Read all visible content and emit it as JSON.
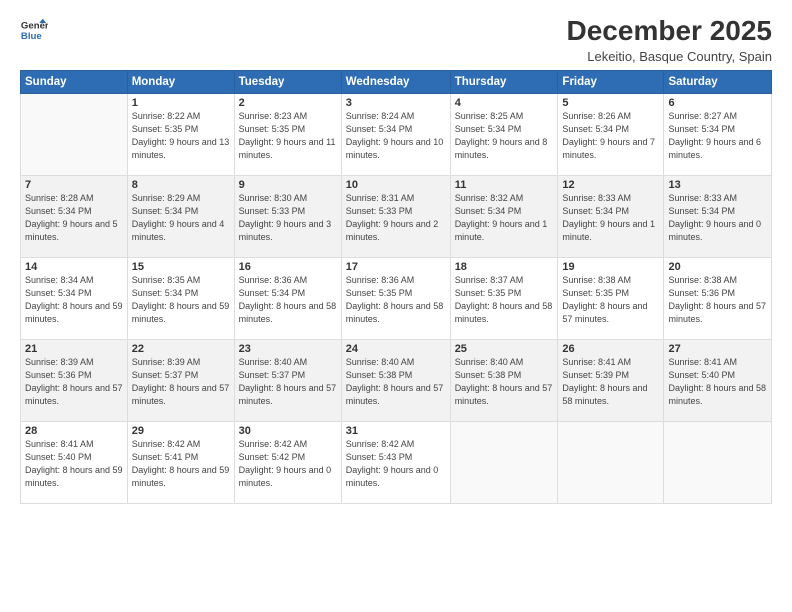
{
  "logo": {
    "line1": "General",
    "line2": "Blue"
  },
  "title": "December 2025",
  "subtitle": "Lekeitio, Basque Country, Spain",
  "days_of_week": [
    "Sunday",
    "Monday",
    "Tuesday",
    "Wednesday",
    "Thursday",
    "Friday",
    "Saturday"
  ],
  "weeks": [
    [
      {
        "day": "",
        "info": ""
      },
      {
        "day": "1",
        "info": "Sunrise: 8:22 AM\nSunset: 5:35 PM\nDaylight: 9 hours\nand 13 minutes."
      },
      {
        "day": "2",
        "info": "Sunrise: 8:23 AM\nSunset: 5:35 PM\nDaylight: 9 hours\nand 11 minutes."
      },
      {
        "day": "3",
        "info": "Sunrise: 8:24 AM\nSunset: 5:34 PM\nDaylight: 9 hours\nand 10 minutes."
      },
      {
        "day": "4",
        "info": "Sunrise: 8:25 AM\nSunset: 5:34 PM\nDaylight: 9 hours\nand 8 minutes."
      },
      {
        "day": "5",
        "info": "Sunrise: 8:26 AM\nSunset: 5:34 PM\nDaylight: 9 hours\nand 7 minutes."
      },
      {
        "day": "6",
        "info": "Sunrise: 8:27 AM\nSunset: 5:34 PM\nDaylight: 9 hours\nand 6 minutes."
      }
    ],
    [
      {
        "day": "7",
        "info": "Sunrise: 8:28 AM\nSunset: 5:34 PM\nDaylight: 9 hours\nand 5 minutes."
      },
      {
        "day": "8",
        "info": "Sunrise: 8:29 AM\nSunset: 5:34 PM\nDaylight: 9 hours\nand 4 minutes."
      },
      {
        "day": "9",
        "info": "Sunrise: 8:30 AM\nSunset: 5:33 PM\nDaylight: 9 hours\nand 3 minutes."
      },
      {
        "day": "10",
        "info": "Sunrise: 8:31 AM\nSunset: 5:33 PM\nDaylight: 9 hours\nand 2 minutes."
      },
      {
        "day": "11",
        "info": "Sunrise: 8:32 AM\nSunset: 5:34 PM\nDaylight: 9 hours\nand 1 minute."
      },
      {
        "day": "12",
        "info": "Sunrise: 8:33 AM\nSunset: 5:34 PM\nDaylight: 9 hours\nand 1 minute."
      },
      {
        "day": "13",
        "info": "Sunrise: 8:33 AM\nSunset: 5:34 PM\nDaylight: 9 hours\nand 0 minutes."
      }
    ],
    [
      {
        "day": "14",
        "info": "Sunrise: 8:34 AM\nSunset: 5:34 PM\nDaylight: 8 hours\nand 59 minutes."
      },
      {
        "day": "15",
        "info": "Sunrise: 8:35 AM\nSunset: 5:34 PM\nDaylight: 8 hours\nand 59 minutes."
      },
      {
        "day": "16",
        "info": "Sunrise: 8:36 AM\nSunset: 5:34 PM\nDaylight: 8 hours\nand 58 minutes."
      },
      {
        "day": "17",
        "info": "Sunrise: 8:36 AM\nSunset: 5:35 PM\nDaylight: 8 hours\nand 58 minutes."
      },
      {
        "day": "18",
        "info": "Sunrise: 8:37 AM\nSunset: 5:35 PM\nDaylight: 8 hours\nand 58 minutes."
      },
      {
        "day": "19",
        "info": "Sunrise: 8:38 AM\nSunset: 5:35 PM\nDaylight: 8 hours\nand 57 minutes."
      },
      {
        "day": "20",
        "info": "Sunrise: 8:38 AM\nSunset: 5:36 PM\nDaylight: 8 hours\nand 57 minutes."
      }
    ],
    [
      {
        "day": "21",
        "info": "Sunrise: 8:39 AM\nSunset: 5:36 PM\nDaylight: 8 hours\nand 57 minutes."
      },
      {
        "day": "22",
        "info": "Sunrise: 8:39 AM\nSunset: 5:37 PM\nDaylight: 8 hours\nand 57 minutes."
      },
      {
        "day": "23",
        "info": "Sunrise: 8:40 AM\nSunset: 5:37 PM\nDaylight: 8 hours\nand 57 minutes."
      },
      {
        "day": "24",
        "info": "Sunrise: 8:40 AM\nSunset: 5:38 PM\nDaylight: 8 hours\nand 57 minutes."
      },
      {
        "day": "25",
        "info": "Sunrise: 8:40 AM\nSunset: 5:38 PM\nDaylight: 8 hours\nand 57 minutes."
      },
      {
        "day": "26",
        "info": "Sunrise: 8:41 AM\nSunset: 5:39 PM\nDaylight: 8 hours\nand 58 minutes."
      },
      {
        "day": "27",
        "info": "Sunrise: 8:41 AM\nSunset: 5:40 PM\nDaylight: 8 hours\nand 58 minutes."
      }
    ],
    [
      {
        "day": "28",
        "info": "Sunrise: 8:41 AM\nSunset: 5:40 PM\nDaylight: 8 hours\nand 59 minutes."
      },
      {
        "day": "29",
        "info": "Sunrise: 8:42 AM\nSunset: 5:41 PM\nDaylight: 8 hours\nand 59 minutes."
      },
      {
        "day": "30",
        "info": "Sunrise: 8:42 AM\nSunset: 5:42 PM\nDaylight: 9 hours\nand 0 minutes."
      },
      {
        "day": "31",
        "info": "Sunrise: 8:42 AM\nSunset: 5:43 PM\nDaylight: 9 hours\nand 0 minutes."
      },
      {
        "day": "",
        "info": ""
      },
      {
        "day": "",
        "info": ""
      },
      {
        "day": "",
        "info": ""
      }
    ]
  ]
}
